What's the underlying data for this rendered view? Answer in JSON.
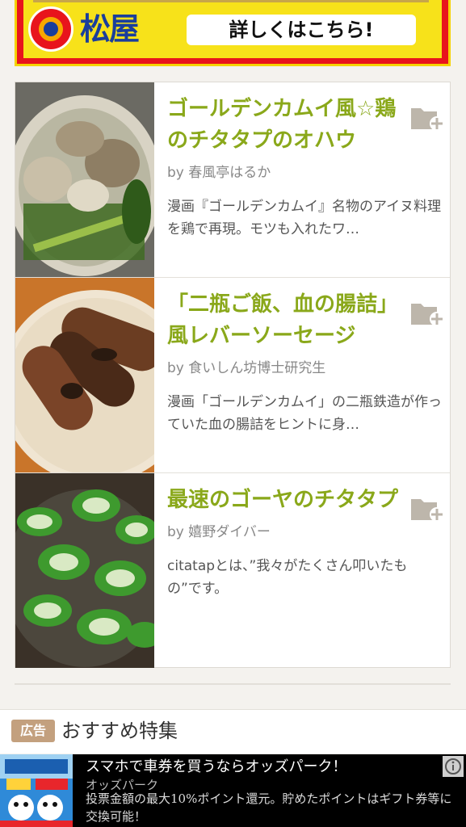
{
  "top_ad": {
    "logo_text": "松屋",
    "cta_label": "詳しくはこちら!"
  },
  "articles": [
    {
      "title": "ゴールデンカムイ風☆鶏のチタタプのオハウ",
      "author": "by 春風亭はるか",
      "description": "漫画『ゴールデンカムイ』名物のアイヌ料理を鶏で再現。モツも入れたワ…",
      "thumbnail": "soup-with-meatballs-and-greens"
    },
    {
      "title": "「二瓶ご飯、血の腸詰」風レバーソーセージ",
      "author": "by 食いしん坊博士研究生",
      "description": "漫画「ゴールデンカムイ」の二瓶鉄造が作っていた血の腸詰をヒントに身…",
      "thumbnail": "grilled-sausages-on-plate"
    },
    {
      "title": "最速のゴーヤのチタタプ",
      "author": "by 嬉野ダイバー",
      "description": "citatapとは、”我々がたくさん叩いたもの”です。",
      "thumbnail": "bitter-melon-slices"
    }
  ],
  "recommended": {
    "badge": "広告",
    "title": "おすすめ特集"
  },
  "bottom_ad": {
    "title": "スマホで車券を買うならオッズパーク！",
    "advertiser": "オッズパーク",
    "description": "投票金額の最大10%ポイント還元。貯めたポイントはギフト券等に交換可能！"
  },
  "colors": {
    "title_green": "#8aa81a",
    "ad_red": "#e8141c",
    "ad_yellow": "#f7e21a",
    "badge_tan": "#c3a07e"
  },
  "icons": {
    "save": "folder-plus-icon",
    "info": "info-icon"
  }
}
